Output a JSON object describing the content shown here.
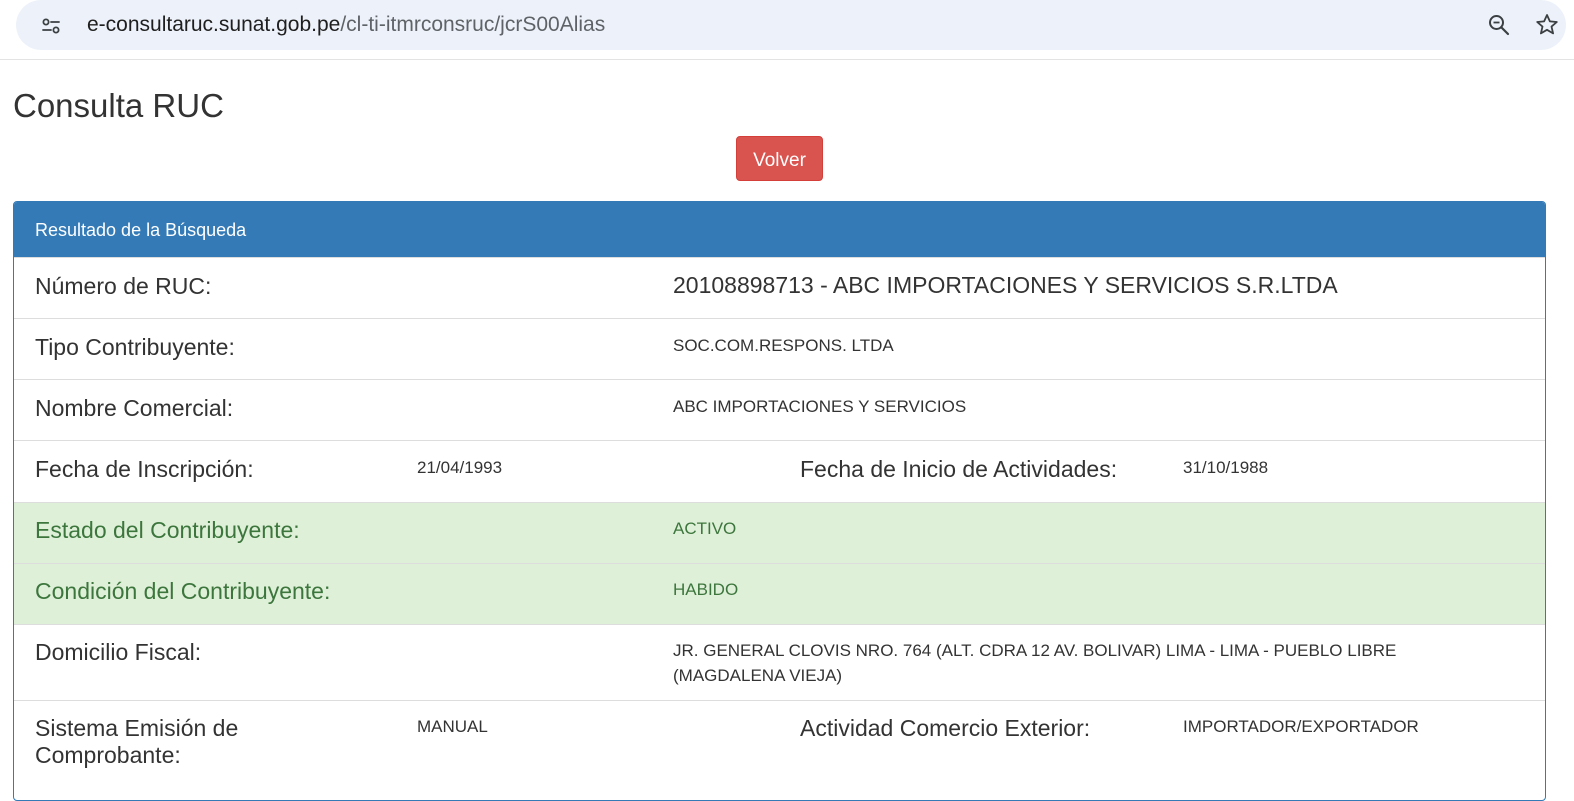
{
  "browser": {
    "url_host": "e-consultaruc.sunat.gob.pe",
    "url_path": "/cl-ti-itmrconsruc/jcrS00Alias",
    "icons": [
      "site-info-icon",
      "zoom-icon",
      "bookmark-star-icon"
    ]
  },
  "page": {
    "title": "Consulta RUC",
    "back_button": "Volver"
  },
  "panel": {
    "heading": "Resultado de la Búsqueda",
    "ruc_label": "Número de RUC:",
    "ruc_value": "20108898713 - ABC IMPORTACIONES Y SERVICIOS S.R.LTDA",
    "tipo_label": "Tipo Contribuyente:",
    "tipo_value": "SOC.COM.RESPONS. LTDA",
    "nombre_label": "Nombre Comercial:",
    "nombre_value": "ABC IMPORTACIONES Y SERVICIOS",
    "inscripcion_label": "Fecha de Inscripción:",
    "inscripcion_value": "21/04/1993",
    "inicio_label": "Fecha de Inicio de Actividades:",
    "inicio_value": "31/10/1988",
    "estado_label": "Estado del Contribuyente:",
    "estado_value": "ACTIVO",
    "condicion_label": "Condición del Contribuyente:",
    "condicion_value": "HABIDO",
    "domicilio_label": "Domicilio Fiscal:",
    "domicilio_value_line1": "JR. GENERAL CLOVIS NRO. 764 (ALT. CDRA 12 AV. BOLIVAR) LIMA - LIMA - PUEBLO LIBRE",
    "domicilio_value_line2": "(MAGDALENA VIEJA)",
    "sistema_label_line1": "Sistema Emisión de",
    "sistema_label_line2": "Comprobante:",
    "sistema_value": "MANUAL",
    "comercio_label": "Actividad Comercio Exterior:",
    "comercio_value": "IMPORTADOR/EXPORTADOR"
  },
  "colors": {
    "panel_primary": "#337ab7",
    "danger_button": "#d9534f",
    "success_bg": "#dff0d8",
    "success_text": "#3c763d"
  }
}
